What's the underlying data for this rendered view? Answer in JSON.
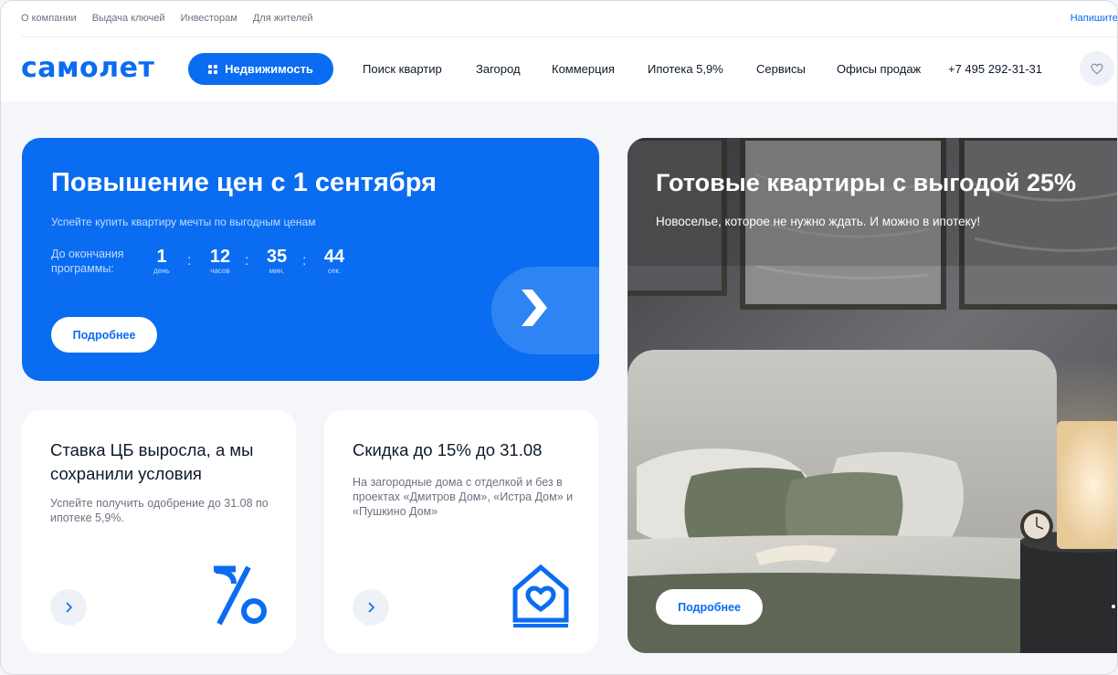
{
  "topbar": {
    "links": [
      "О компании",
      "Выдача ключей",
      "Инвесторам",
      "Для жителей"
    ],
    "write_label": "Напишите н"
  },
  "header": {
    "logo": "самолет",
    "realty_button": "Недвижимость",
    "nav": [
      "Поиск квартир",
      "Загород",
      "Коммерция",
      "Ипотека 5,9%",
      "Сервисы",
      "Офисы продаж"
    ],
    "phone": "+7 495 292-31-31"
  },
  "promo": {
    "title": "Повышение цен с 1 сентября",
    "subtitle": "Успейте купить квартиру мечты по выгодным ценам",
    "countdown_label": "До окончания программы:",
    "countdown": [
      {
        "value": "1",
        "unit": "день"
      },
      {
        "value": "12",
        "unit": "часов"
      },
      {
        "value": "35",
        "unit": "мин."
      },
      {
        "value": "44",
        "unit": "сек."
      }
    ],
    "separator": ":",
    "button": "Подробнее",
    "color": "#0a6cf1"
  },
  "cards": [
    {
      "title": "Ставка ЦБ выросла, а мы сохранили условия",
      "text": "Успейте получить одобрение до 31.08 по ипотеке 5,9%.",
      "icon": "percent-icon"
    },
    {
      "title": "Скидка до 15% до 31.08",
      "text": "На загородные дома с отделкой и без в проектах «Дмитров Дом», «Истра Дом» и «Пушкино Дом»",
      "icon": "house-heart-icon"
    }
  ],
  "photo_banner": {
    "title": "Готовые квартиры с выгодой 25%",
    "subtitle": "Новоселье, которое не нужно ждать. И можно в ипотеку!",
    "button": "Подробнее"
  }
}
